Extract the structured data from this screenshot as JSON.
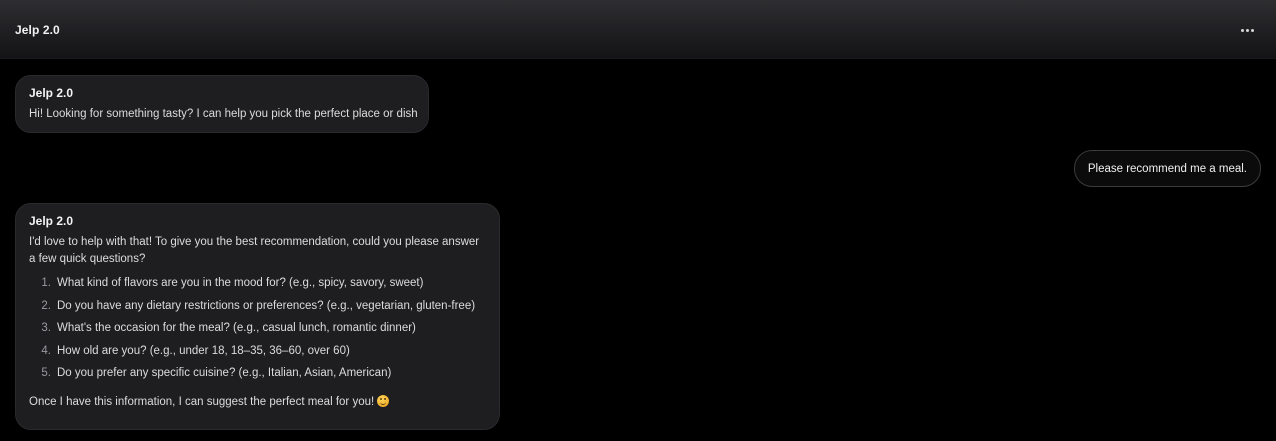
{
  "header": {
    "title": "Jelp 2.0",
    "menu_icon": "more-horizontal-icon"
  },
  "messages": [
    {
      "role": "assistant",
      "sender": "Jelp 2.0",
      "text": "Hi! Looking for something tasty? I can help you pick the perfect place or dish"
    },
    {
      "role": "user",
      "text": "Please recommend me a meal."
    },
    {
      "role": "assistant",
      "sender": "Jelp 2.0",
      "intro": "I'd love to help with that! To give you the best recommendation, could you please answer a few quick questions?",
      "questions": [
        {
          "num": "1.",
          "text": "What kind of flavors are you in the mood for? (e.g., spicy, savory, sweet)"
        },
        {
          "num": "2.",
          "text": "Do you have any dietary restrictions or preferences? (e.g., vegetarian, gluten-free)"
        },
        {
          "num": "3.",
          "text": "What's the occasion for the meal? (e.g., casual lunch, romantic dinner)"
        },
        {
          "num": "4.",
          "text": "How old are you? (e.g., under 18, 18–35, 36–60, over 60)"
        },
        {
          "num": "5.",
          "text": "Do you prefer any specific cuisine? (e.g., Italian, Asian, American)"
        }
      ],
      "outro": "Once I have this information, I can suggest the perfect meal for you!",
      "outro_icon": "smiling-face-emoji-icon"
    }
  ]
}
